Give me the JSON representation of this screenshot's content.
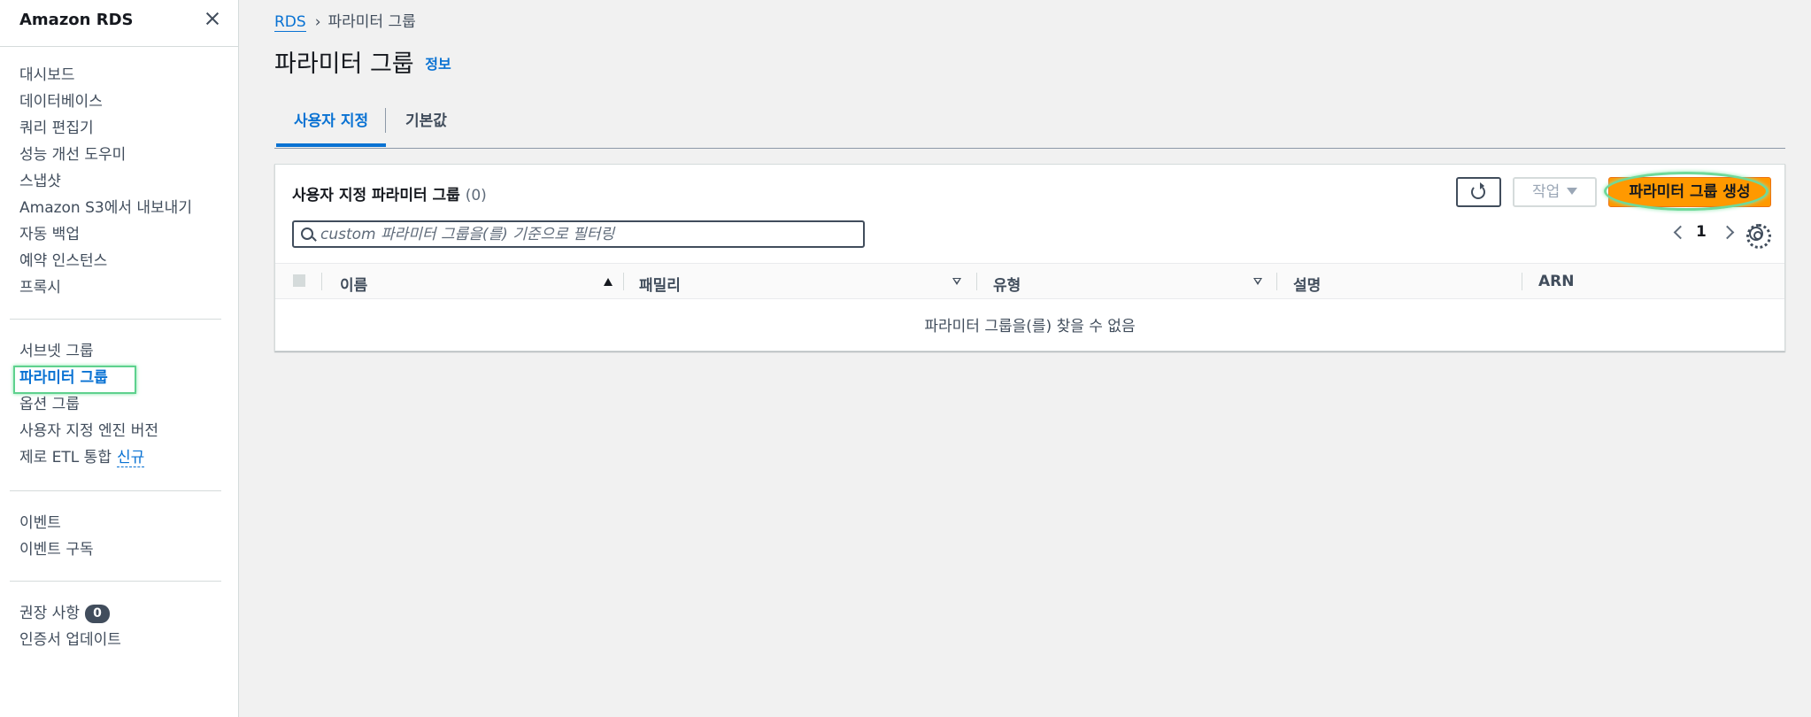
{
  "sidebar": {
    "title": "Amazon RDS",
    "group1": [
      "대시보드",
      "데이터베이스",
      "쿼리 편집기",
      "성능 개선 도우미",
      "스냅샷",
      "Amazon S3에서 내보내기",
      "자동 백업",
      "예약 인스턴스",
      "프록시"
    ],
    "group2": {
      "subnet": "서브넷 그룹",
      "parameter": "파라미터 그룹",
      "option": "옵션 그룹",
      "custom_engine": "사용자 지정 엔진 버전",
      "zero_etl": "제로 ETL 통합",
      "new_badge": "신규"
    },
    "group3": [
      "이벤트",
      "이벤트 구독"
    ],
    "group4": {
      "recommendations": "권장 사항",
      "recommendations_count": "0",
      "cert_update": "인증서 업데이트"
    }
  },
  "breadcrumb": {
    "root": "RDS",
    "current": "파라미터 그룹"
  },
  "page": {
    "title": "파라미터 그룹",
    "info": "정보"
  },
  "tabs": {
    "custom": "사용자 지정",
    "default": "기본값"
  },
  "panel": {
    "title": "사용자 지정 파라미터 그룹",
    "count": "(0)",
    "search_placeholder": "custom 파라미터 그룹을(를) 기준으로 필터링",
    "actions_label": "작업",
    "create_label": "파라미터 그룹 생성",
    "page_number": "1"
  },
  "table": {
    "columns": [
      "이름",
      "패밀리",
      "유형",
      "설명",
      "ARN"
    ],
    "empty": "파라미터 그룹을(를) 찾을 수 없음"
  },
  "colors": {
    "accent": "#0972d3",
    "primary_button": "#ff9900",
    "highlight": "#5ed18e"
  }
}
